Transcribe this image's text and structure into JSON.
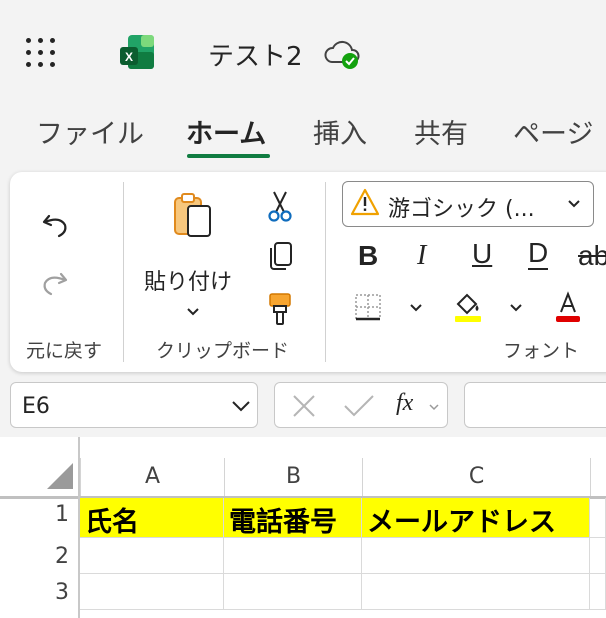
{
  "app": {
    "title": "テスト2",
    "logo_letter": "X",
    "icons": [
      "waffle-icon",
      "excel-logo-icon",
      "cloud-saved-icon"
    ]
  },
  "tabs": [
    {
      "label": "ファイル",
      "active": false
    },
    {
      "label": "ホーム",
      "active": true
    },
    {
      "label": "挿入",
      "active": false
    },
    {
      "label": "共有",
      "active": false
    },
    {
      "label": "ページ",
      "active": false
    }
  ],
  "ribbon": {
    "undo_group_label": "元に戻す",
    "clipboard_group_label": "クリップボード",
    "paste_label": "貼り付け",
    "font_group_label": "フォント",
    "font_name": "游ゴシック (...",
    "format_buttons": [
      "B",
      "I",
      "U",
      "D",
      "ab"
    ],
    "colors": {
      "highlight": "#ffff00",
      "font_color": "#e00000",
      "accent": "#107c41"
    }
  },
  "formula_bar": {
    "name_box": "E6",
    "fx_label": "fx",
    "formula": ""
  },
  "sheet": {
    "columns": [
      "A",
      "B",
      "C"
    ],
    "rows": [
      {
        "num": "1",
        "cells": [
          "氏名",
          "電話番号",
          "メールアドレス"
        ],
        "fill": "#ffff00"
      },
      {
        "num": "2",
        "cells": [
          "",
          "",
          ""
        ]
      },
      {
        "num": "3",
        "cells": [
          "",
          "",
          ""
        ]
      }
    ]
  }
}
